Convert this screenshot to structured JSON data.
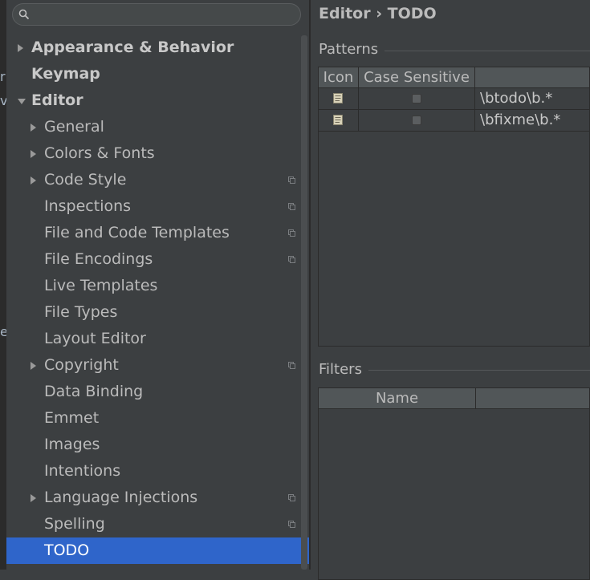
{
  "background_window": {
    "fragments": [
      "r",
      "v",
      "e"
    ]
  },
  "search": {
    "value": "",
    "placeholder": ""
  },
  "tree": [
    {
      "label": "Appearance & Behavior",
      "expander": "collapsed",
      "level": 0,
      "bold": true
    },
    {
      "label": "Keymap",
      "expander": "none",
      "level": 0,
      "bold": true
    },
    {
      "label": "Editor",
      "expander": "expanded",
      "level": 0,
      "bold": true
    },
    {
      "label": "General",
      "expander": "collapsed",
      "level": 1
    },
    {
      "label": "Colors & Fonts",
      "expander": "collapsed",
      "level": 1
    },
    {
      "label": "Code Style",
      "expander": "collapsed",
      "level": 1,
      "project": true
    },
    {
      "label": "Inspections",
      "expander": "none",
      "level": 1,
      "project": true
    },
    {
      "label": "File and Code Templates",
      "expander": "none",
      "level": 1,
      "project": true
    },
    {
      "label": "File Encodings",
      "expander": "none",
      "level": 1,
      "project": true
    },
    {
      "label": "Live Templates",
      "expander": "none",
      "level": 1
    },
    {
      "label": "File Types",
      "expander": "none",
      "level": 1
    },
    {
      "label": "Layout Editor",
      "expander": "none",
      "level": 1
    },
    {
      "label": "Copyright",
      "expander": "collapsed",
      "level": 1,
      "project": true
    },
    {
      "label": "Data Binding",
      "expander": "none",
      "level": 1
    },
    {
      "label": "Emmet",
      "expander": "none",
      "level": 1
    },
    {
      "label": "Images",
      "expander": "none",
      "level": 1
    },
    {
      "label": "Intentions",
      "expander": "none",
      "level": 1
    },
    {
      "label": "Language Injections",
      "expander": "collapsed",
      "level": 1,
      "project": true
    },
    {
      "label": "Spelling",
      "expander": "none",
      "level": 1,
      "project": true
    },
    {
      "label": "TODO",
      "expander": "none",
      "level": 1,
      "selected": true
    }
  ],
  "breadcrumb": "Editor › TODO",
  "patterns": {
    "title": "Patterns",
    "columns": [
      "Icon",
      "Case Sensitive",
      ""
    ],
    "rows": [
      {
        "icon": "note-icon",
        "case_sensitive": false,
        "pattern": "\\btodo\\b.*"
      },
      {
        "icon": "note-icon",
        "case_sensitive": false,
        "pattern": "\\bfixme\\b.*"
      }
    ]
  },
  "filters": {
    "title": "Filters",
    "columns": [
      "Name",
      ""
    ]
  },
  "colors": {
    "selection": "#2f65ca",
    "panel": "#3c3f41",
    "header": "#515658",
    "text": "#bbbbbb"
  }
}
